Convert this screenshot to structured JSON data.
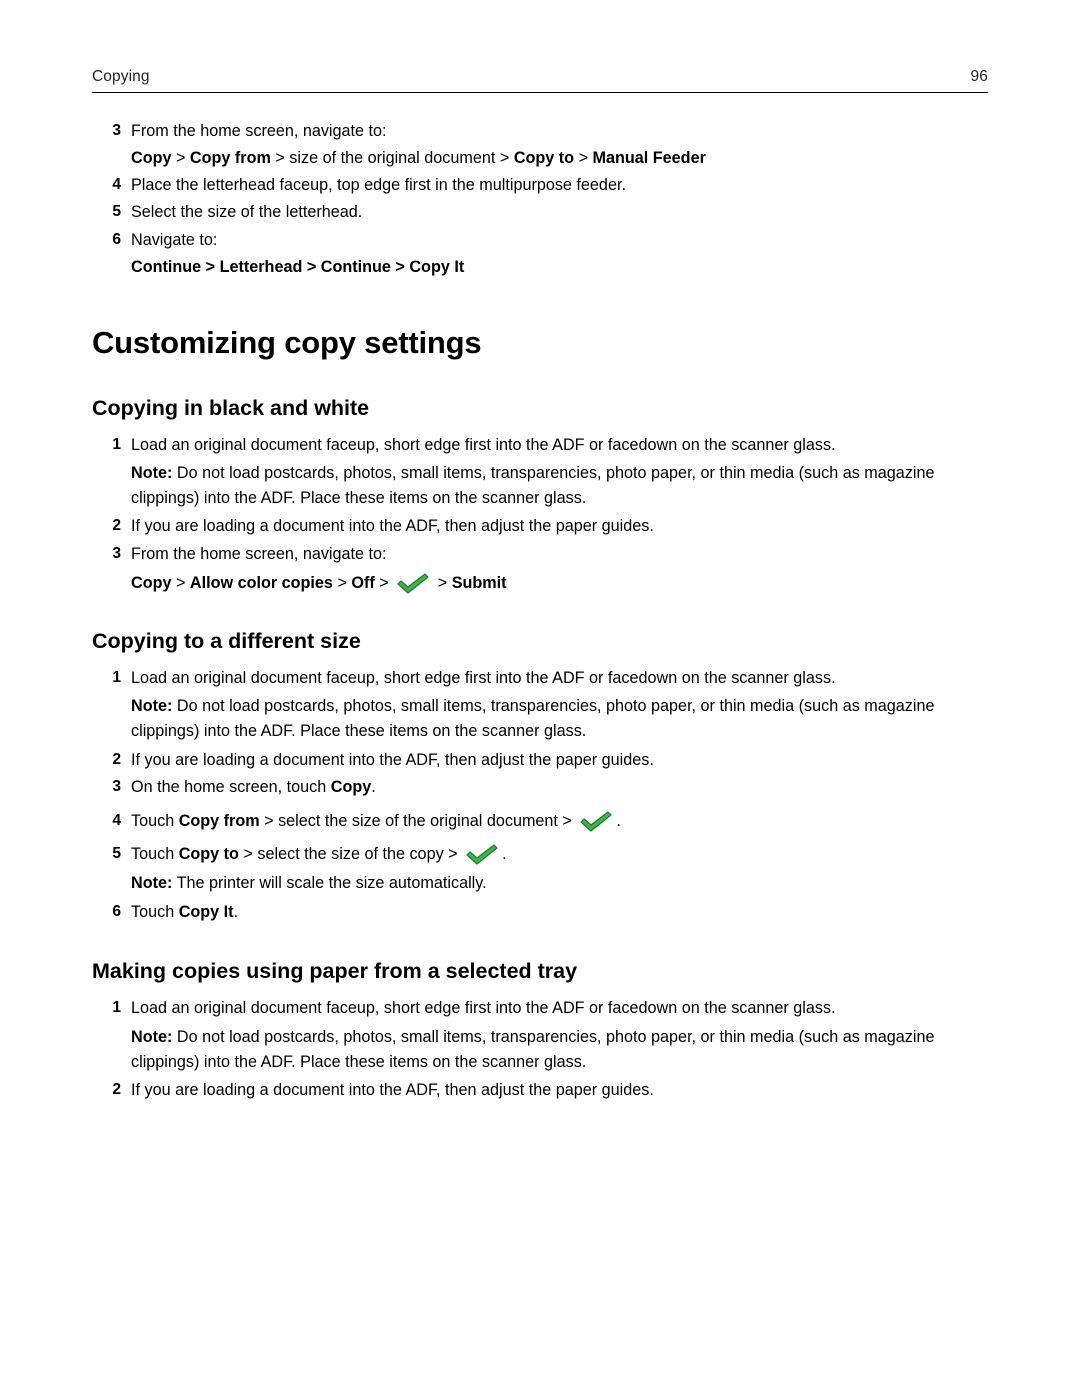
{
  "header": {
    "section": "Copying",
    "page_number": "96"
  },
  "top_steps": [
    {
      "num": "3",
      "text": "From the home screen, navigate to:"
    },
    {
      "num": "4",
      "text": "Place the letterhead faceup, top edge first in the multipurpose feeder."
    },
    {
      "num": "5",
      "text": "Select the size of the letterhead."
    },
    {
      "num": "6",
      "text": "Navigate to:"
    }
  ],
  "breadcrumb_1": {
    "parts": [
      "Copy",
      " > ",
      "Copy from",
      " > size of the original document > ",
      "Copy to",
      " > ",
      "Manual Feeder"
    ],
    "plain": "Copy > Copy from > size of the original document > Copy to > Manual Feeder"
  },
  "breadcrumb_2": {
    "plain": "Continue > Letterhead > Continue > Copy It"
  },
  "title": "Customizing copy settings",
  "sections": [
    {
      "heading": "Copying in black and white",
      "steps": [
        {
          "num": "1",
          "text": "Load an original document faceup, short edge first into the ADF or facedown on the scanner glass."
        }
      ],
      "note_label": "Note:",
      "note_text": " Do not load postcards, photos, small items, transparencies, photo paper, or thin media (such as magazine clippings) into the ADF. Place these items on the scanner glass.",
      "steps2": [
        {
          "num": "2",
          "text": "If you are loading a document into the ADF, then adjust the paper guides."
        },
        {
          "num": "3",
          "text": "From the home screen, navigate to:"
        }
      ],
      "breadcrumb_bold_a": "Copy",
      "breadcrumb_sep1": " > ",
      "breadcrumb_bold_b": "Allow color copies",
      "breadcrumb_sep2": " > ",
      "breadcrumb_bold_c": "Off",
      "breadcrumb_sep3": " > ",
      "breadcrumb_icon": "green-checkmark-icon",
      "breadcrumb_sep4": " > ",
      "breadcrumb_bold_d": "Submit"
    }
  ],
  "section_different_size": {
    "heading": "Copying to a different size",
    "step1": {
      "num": "1",
      "text": "Load an original document faceup, short edge first into the ADF or facedown on the scanner glass."
    },
    "note_label": "Note:",
    "note_text": " Do not load postcards, photos, small items, transparencies, photo paper, or thin media (such as magazine clippings) into the ADF. Place these items on the scanner glass.",
    "step2": {
      "num": "2",
      "text": "If you are loading a document into the ADF, then adjust the paper guides."
    },
    "step3": {
      "num": "3",
      "pre": "On the home screen, touch ",
      "bold": "Copy",
      "post": "."
    },
    "step4": {
      "num": "4",
      "pre": "Touch ",
      "bold": "Copy from",
      "mid": " > select the size of the original document > ",
      "post": "."
    },
    "step5": {
      "num": "5",
      "pre": "Touch ",
      "bold": "Copy to",
      "mid": " > select the size of the copy > ",
      "post": "."
    },
    "note2_label": "Note:",
    "note2_text": " The printer will scale the size automatically.",
    "step6": {
      "num": "6",
      "pre": "Touch ",
      "bold": "Copy It",
      "post": "."
    }
  },
  "section_selected_tray": {
    "heading": "Making copies using paper from a selected tray",
    "step1": {
      "num": "1",
      "text": "Load an original document faceup, short edge first into the ADF or facedown on the scanner glass."
    },
    "note_label": "Note:",
    "note_text": " Do not load postcards, photos, small items, transparencies, photo paper, or thin media (such as magazine clippings) into the ADF. Place these items on the scanner glass.",
    "step2": {
      "num": "2",
      "text": "If you are loading a document into the ADF, then adjust the paper guides."
    }
  },
  "colors": {
    "check_fill": "#3cb54a",
    "check_stroke": "#1f7a2e",
    "rule": "#000000"
  }
}
